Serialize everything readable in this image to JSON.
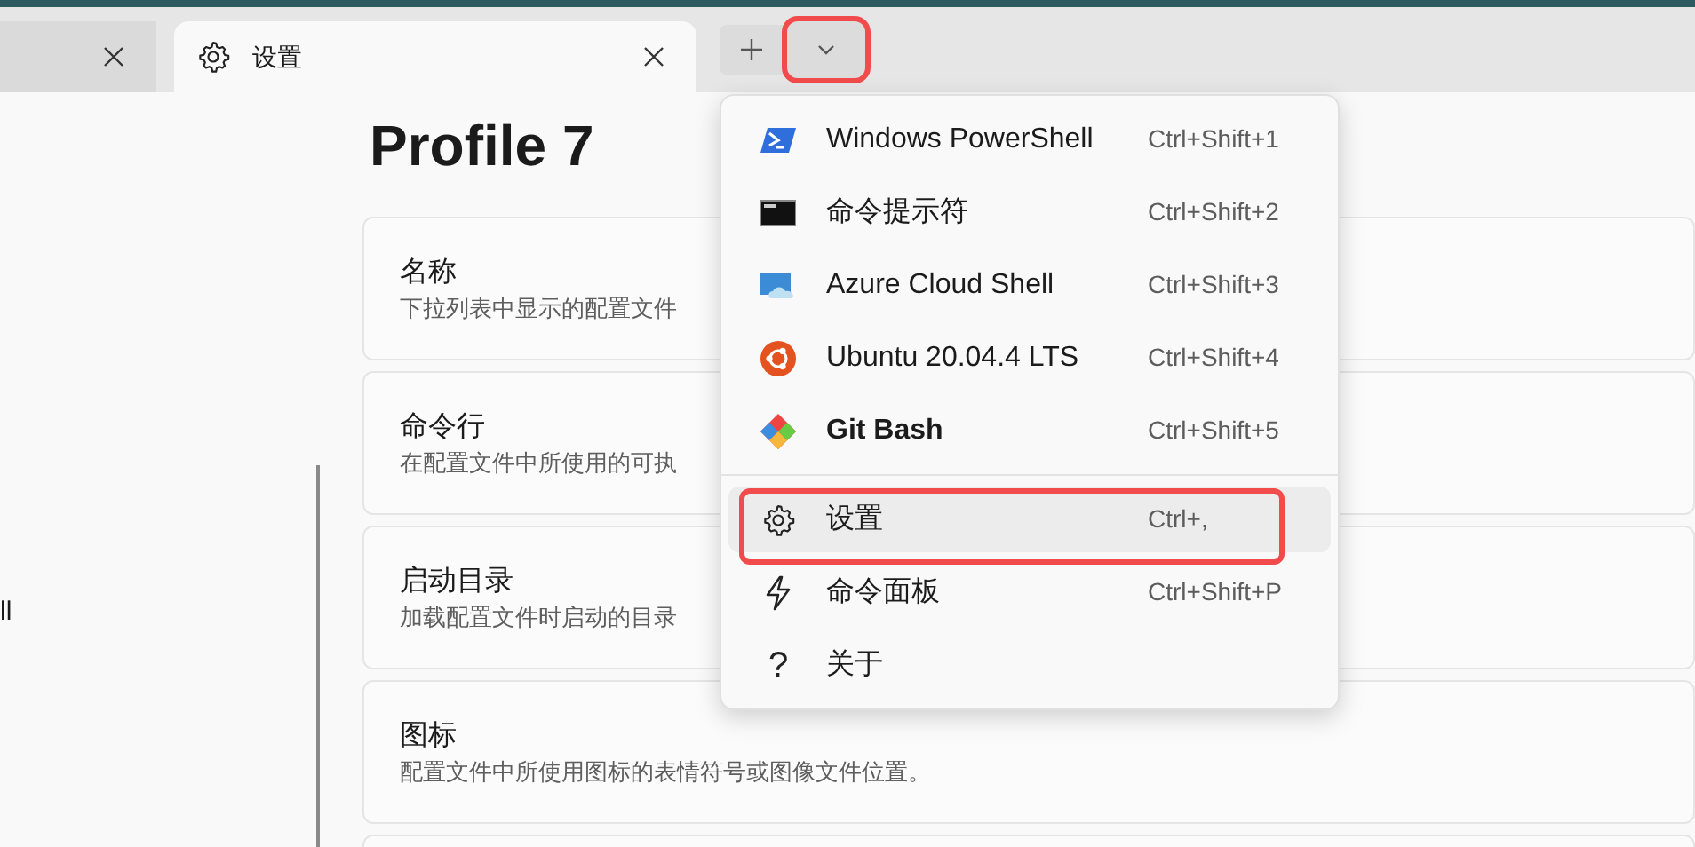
{
  "tabs": [
    {
      "selected": false
    },
    {
      "label": "设置",
      "selected": true
    }
  ],
  "new_tab_button": {
    "annotated": false
  },
  "dropdown_button": {
    "annotated": true
  },
  "sidebar": {
    "items": [
      {
        "label": "ll"
      }
    ]
  },
  "page": {
    "title": "Profile 7",
    "cards": [
      {
        "title": "名称",
        "description": "下拉列表中显示的配置文件"
      },
      {
        "title": "命令行",
        "description": "在配置文件中所使用的可执"
      },
      {
        "title": "启动目录",
        "description": "加载配置文件时启动的目录"
      },
      {
        "title": "图标",
        "description": "配置文件中所使用图标的表情符号或图像文件位置。"
      }
    ]
  },
  "menu": {
    "items": [
      {
        "kind": "powershell",
        "label": "Windows PowerShell",
        "shortcut": "Ctrl+Shift+1",
        "is_default": false,
        "selected": false,
        "annotated": false
      },
      {
        "kind": "cmd",
        "label": "命令提示符",
        "shortcut": "Ctrl+Shift+2",
        "is_default": false,
        "selected": false,
        "annotated": false
      },
      {
        "kind": "azure",
        "label": "Azure Cloud Shell",
        "shortcut": "Ctrl+Shift+3",
        "is_default": false,
        "selected": false,
        "annotated": false
      },
      {
        "kind": "ubuntu",
        "label": "Ubuntu 20.04.4 LTS",
        "shortcut": "Ctrl+Shift+4",
        "is_default": false,
        "selected": false,
        "annotated": false
      },
      {
        "kind": "git",
        "label": "Git Bash",
        "shortcut": "Ctrl+Shift+5",
        "is_default": true,
        "selected": false,
        "annotated": false
      },
      {
        "kind": "separator"
      },
      {
        "kind": "gear",
        "label": "设置",
        "shortcut": "Ctrl+,",
        "is_default": false,
        "selected": true,
        "annotated": true
      },
      {
        "kind": "bolt",
        "label": "命令面板",
        "shortcut": "Ctrl+Shift+P",
        "is_default": false,
        "selected": false,
        "annotated": false
      },
      {
        "kind": "glyph",
        "glyph": "?",
        "label": "关于",
        "is_default": false,
        "selected": false,
        "annotated": false
      }
    ]
  }
}
